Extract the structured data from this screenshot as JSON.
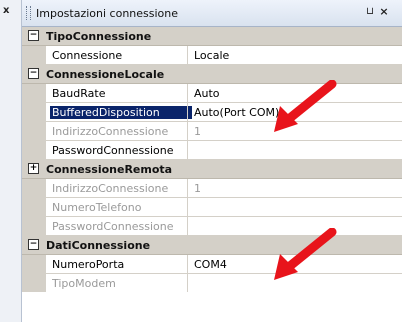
{
  "left_panel": {
    "close_glyph": "x"
  },
  "window": {
    "title": "Impostazioni connessione",
    "pin_glyph": "⊔",
    "close_glyph": "×"
  },
  "categories": [
    {
      "toggle": "−",
      "label": "TipoConnessione",
      "props": [
        {
          "name": "Connessione",
          "value": "Locale",
          "disabled": false
        }
      ]
    },
    {
      "toggle": "−",
      "label": "ConnessioneLocale",
      "props": [
        {
          "name": "BaudRate",
          "value": "Auto",
          "disabled": false
        },
        {
          "name": "BufferedDisposition",
          "value": "Auto(Port COM)",
          "disabled": false,
          "selected": true
        },
        {
          "name": "IndirizzoConnessione",
          "value": "1",
          "disabled": true
        },
        {
          "name": "PasswordConnessione",
          "value": "",
          "disabled": false
        }
      ]
    },
    {
      "toggle": "+",
      "label": "ConnessioneRemota",
      "props": [
        {
          "name": "IndirizzoConnessione",
          "value": "1",
          "disabled": true
        },
        {
          "name": "NumeroTelefono",
          "value": "",
          "disabled": true
        },
        {
          "name": "PasswordConnessione",
          "value": "",
          "disabled": true
        }
      ]
    },
    {
      "toggle": "−",
      "label": "DatiConnessione",
      "props": [
        {
          "name": "NumeroPorta",
          "value": "COM4",
          "disabled": false
        },
        {
          "name": "TipoModem",
          "value": "",
          "disabled": true
        }
      ]
    }
  ],
  "annotations": {
    "arrow_color": "#e8141b"
  }
}
